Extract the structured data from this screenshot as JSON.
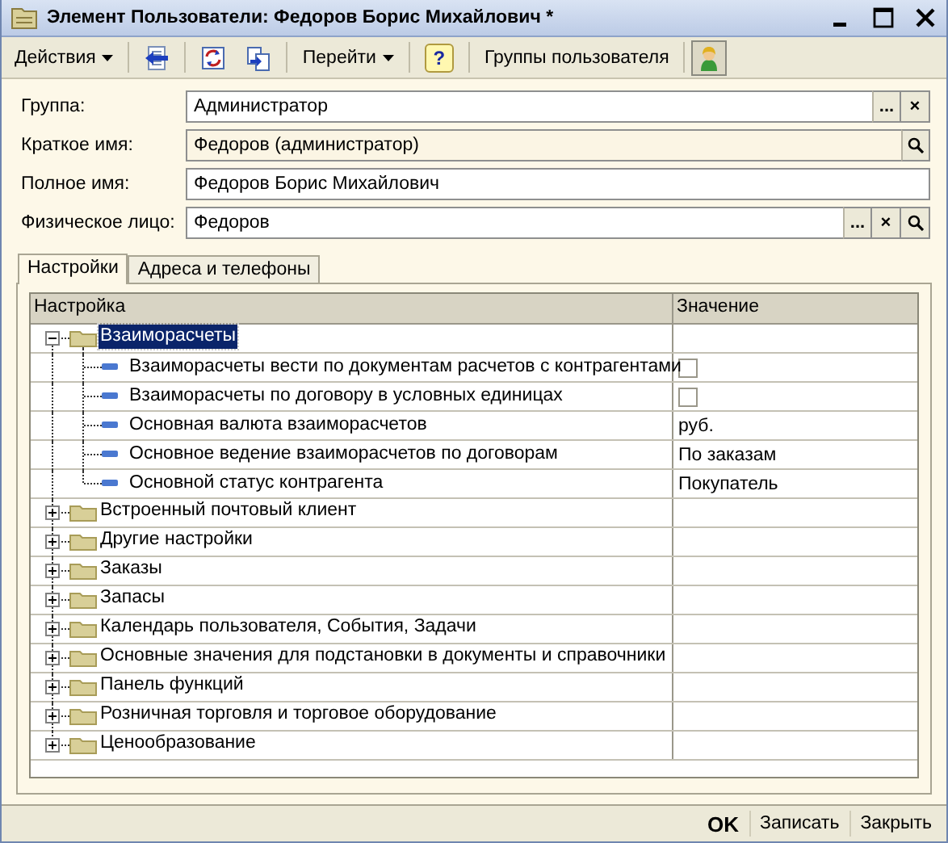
{
  "window": {
    "title": "Элемент Пользователи: Федоров Борис Михайлович *"
  },
  "toolbar": [
    {
      "kind": "menu",
      "label": "Действия"
    },
    {
      "kind": "icon"
    },
    {
      "kind": "icon"
    },
    {
      "kind": "icon"
    },
    {
      "kind": "menu",
      "label": "Перейти"
    },
    {
      "kind": "help",
      "label": "?"
    },
    {
      "kind": "button",
      "label": "Группы пользователя"
    },
    {
      "kind": "toggle",
      "pressed": true
    }
  ],
  "fields": [
    {
      "label": "Группа:",
      "value": "Администратор",
      "readonly": false,
      "buttons": [
        {
          "kind": "select",
          "text": "..."
        },
        {
          "kind": "clear",
          "text": "×"
        }
      ]
    },
    {
      "label": "Краткое имя:",
      "value": "Федоров (администратор)",
      "readonly": true,
      "buttons": [
        {
          "kind": "search"
        }
      ]
    },
    {
      "label": "Полное имя:",
      "value": "Федоров Борис Михайлович",
      "readonly": false
    },
    {
      "label": "Физическое лицо:",
      "value": "Федоров",
      "readonly": false,
      "buttons": [
        {
          "kind": "select",
          "text": "..."
        },
        {
          "kind": "clear",
          "text": "×"
        },
        {
          "kind": "search"
        }
      ]
    }
  ],
  "tabs": [
    {
      "label": "Настройки",
      "selected": true
    },
    {
      "label": "Адреса и телефоны",
      "selected": false
    }
  ],
  "table": {
    "columns": [
      "Настройка",
      "Значение"
    ],
    "rows": [
      {
        "label": "Взаиморасчеты",
        "expanded": true,
        "selected": true,
        "children": [
          {
            "label": "Взаиморасчеты вести по документам расчетов с контрагентами",
            "value": {
              "kind": "checkbox",
              "checked": false
            }
          },
          {
            "label": "Взаиморасчеты по договору в условных единицах",
            "value": {
              "kind": "checkbox",
              "checked": false
            }
          },
          {
            "label": "Основная валюта взаиморасчетов",
            "value": {
              "kind": "text",
              "text": "руб."
            }
          },
          {
            "label": "Основное ведение взаиморасчетов по договорам",
            "value": {
              "kind": "text",
              "text": "По заказам"
            }
          },
          {
            "label": "Основной статус контрагента",
            "value": {
              "kind": "text",
              "text": "Покупатель"
            }
          }
        ]
      },
      {
        "label": "Встроенный почтовый клиент",
        "expanded": false,
        "selected": false
      },
      {
        "label": "Другие настройки",
        "expanded": false,
        "selected": false
      },
      {
        "label": "Заказы",
        "expanded": false,
        "selected": false
      },
      {
        "label": "Запасы",
        "expanded": false,
        "selected": false
      },
      {
        "label": "Календарь пользователя, События, Задачи",
        "expanded": false,
        "selected": false
      },
      {
        "label": "Основные значения для подстановки в документы и справочники",
        "expanded": false,
        "selected": false
      },
      {
        "label": "Панель функций",
        "expanded": false,
        "selected": false
      },
      {
        "label": "Розничная торговля и торговое оборудование",
        "expanded": false,
        "selected": false
      },
      {
        "label": "Ценообразование",
        "expanded": false,
        "selected": false
      }
    ]
  },
  "footer": [
    {
      "label": "OK",
      "default": true
    },
    {
      "label": "Записать",
      "default": false
    },
    {
      "label": "Закрыть",
      "default": false
    }
  ]
}
